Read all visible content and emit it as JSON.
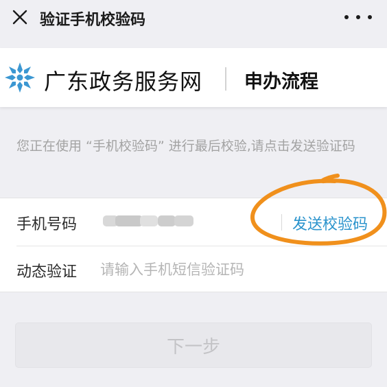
{
  "topbar": {
    "close_icon": "close-x-icon",
    "title": "验证手机校验码",
    "more_icon": "more-dots-icon"
  },
  "brand": {
    "logo_icon": "guangdong-gov-snowflake-logo",
    "name": "广东政务服务网",
    "section": "申办流程"
  },
  "hint": "您正在使用 “手机校验码” 进行最后校验,请点击发送验证码",
  "form": {
    "phone_label": "手机号码",
    "phone_value_obscured": true,
    "send_code_label": "发送校验码",
    "code_label": "动态验证",
    "code_value": "",
    "code_placeholder": "请输入手机短信验证码"
  },
  "annotation": {
    "type": "hand-drawn-circle",
    "target": "send-code-button",
    "color": "#f0901c"
  },
  "next_button": {
    "label": "下一步",
    "disabled": true
  },
  "colors": {
    "background": "#efeff3",
    "link": "#2a93cc",
    "logo": "#3b97d2",
    "hint_text": "#a3a3a3"
  }
}
